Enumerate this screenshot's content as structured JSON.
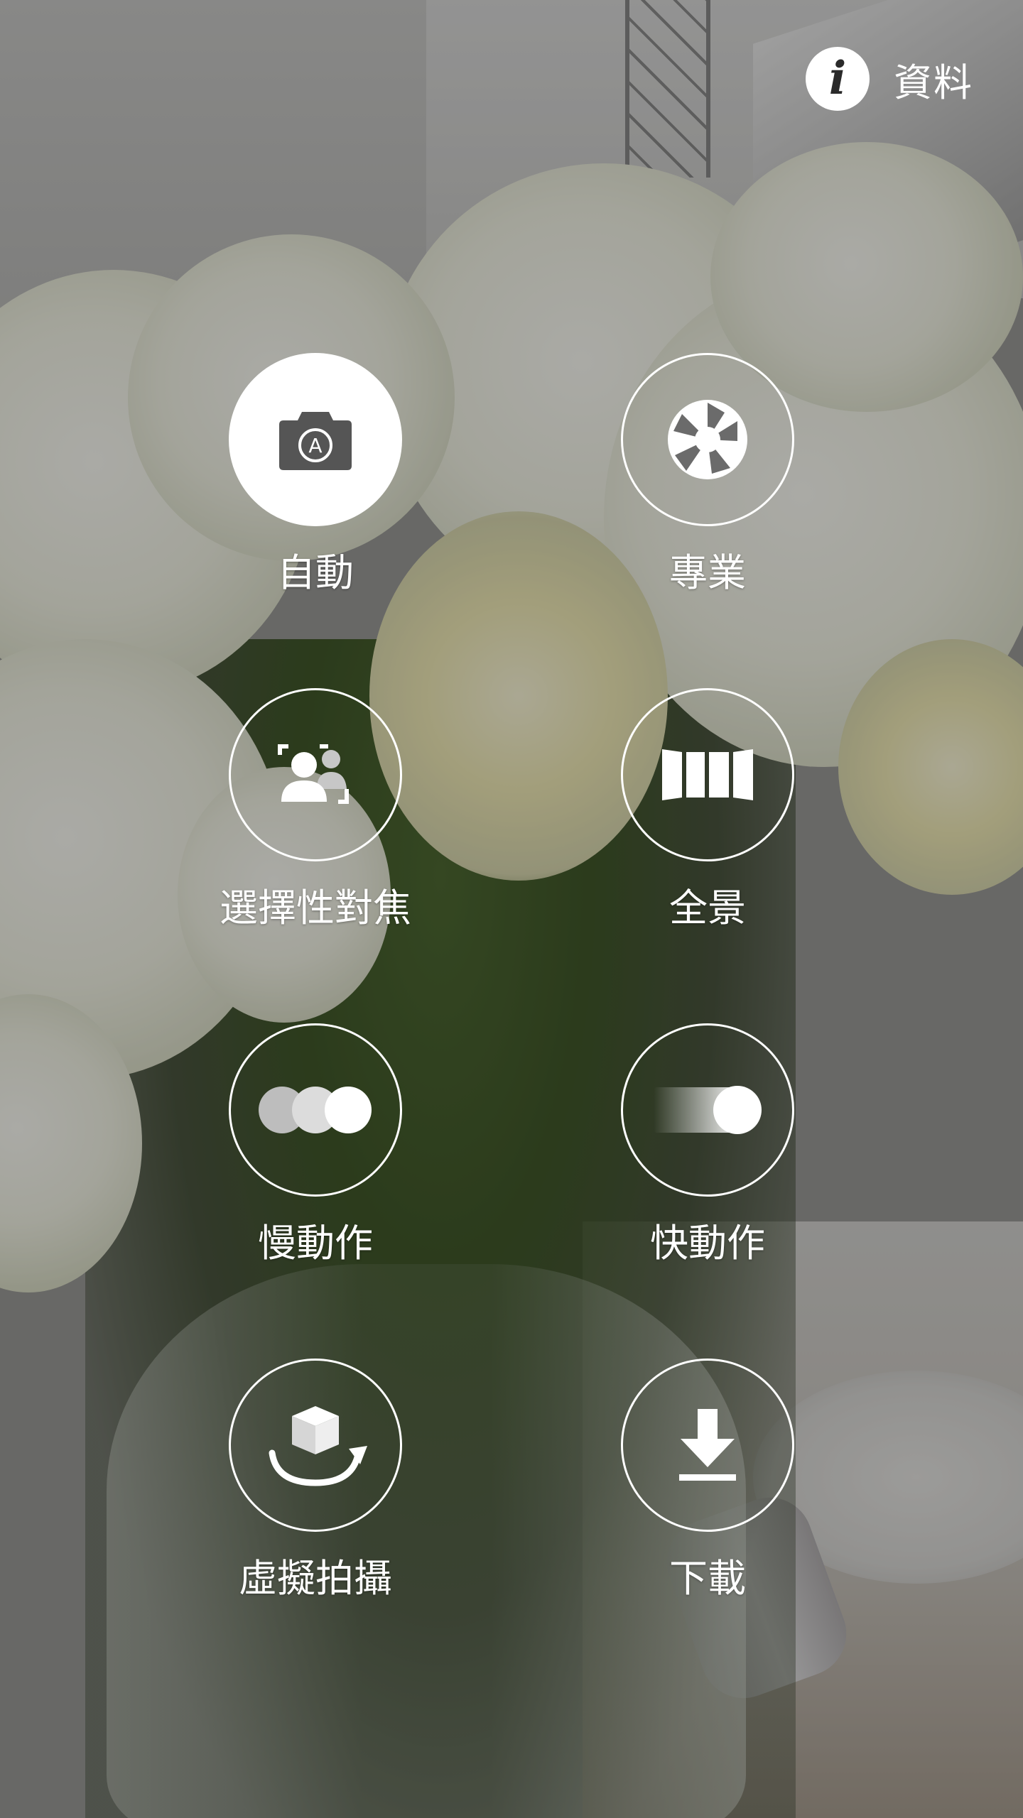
{
  "header": {
    "info_icon": "info-icon",
    "info_label": "資料"
  },
  "modes": [
    {
      "id": "auto",
      "label": "自動",
      "icon": "camera-auto-icon",
      "selected": true
    },
    {
      "id": "pro",
      "label": "專業",
      "icon": "aperture-icon",
      "selected": false
    },
    {
      "id": "selective-focus",
      "label": "選擇性對焦",
      "icon": "selective-focus-icon",
      "selected": false
    },
    {
      "id": "panorama",
      "label": "全景",
      "icon": "panorama-icon",
      "selected": false
    },
    {
      "id": "slow-motion",
      "label": "慢動作",
      "icon": "slow-motion-icon",
      "selected": false
    },
    {
      "id": "fast-motion",
      "label": "快動作",
      "icon": "fast-motion-icon",
      "selected": false
    },
    {
      "id": "virtual-shot",
      "label": "虛擬拍攝",
      "icon": "virtual-shot-icon",
      "selected": false
    },
    {
      "id": "download",
      "label": "下載",
      "icon": "download-icon",
      "selected": false
    }
  ],
  "colors": {
    "overlay_text": "#ffffff",
    "selected_fill": "#ffffff",
    "selected_icon": "#555555"
  }
}
